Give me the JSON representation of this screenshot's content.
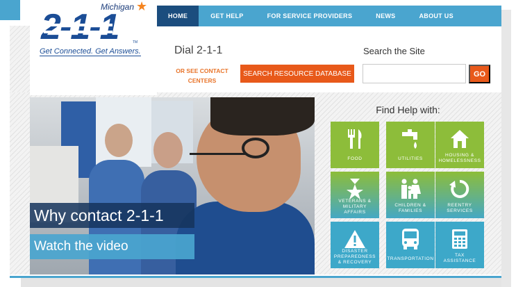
{
  "logo": {
    "state": "Michigan",
    "number": "2-1-1",
    "tagline": "Get Connected. Get Answers.",
    "tm": "TM"
  },
  "nav": {
    "items": [
      "HOME",
      "GET HELP",
      "FOR SERVICE PROVIDERS",
      "NEWS",
      "ABOUT US"
    ],
    "active": "HOME"
  },
  "header": {
    "dial": "Dial 2-1-1",
    "or_see_line1": "OR SEE CONTACT",
    "or_see_line2": "CENTERS",
    "search_db_button": "SEARCH RESOURCE DATABASE",
    "search_label": "Search the Site",
    "search_value": "",
    "go_button": "GO"
  },
  "hero": {
    "headline": "Why contact 2-1-1",
    "video_link": "Watch the video"
  },
  "find_help": {
    "title": "Find Help with:",
    "tiles": [
      {
        "lines": [
          "FOOD"
        ],
        "icon": "fork-knife-icon",
        "style": "green"
      },
      {
        "lines": [
          "UTILITIES"
        ],
        "icon": "faucet-icon",
        "style": "green"
      },
      {
        "lines": [
          "HOUSING &",
          "HOMELESSNESS"
        ],
        "icon": "house-icon",
        "style": "green"
      },
      {
        "lines": [
          "VETERANS &",
          "MILITARY",
          "AFFAIRS"
        ],
        "icon": "medal-icon",
        "style": "gtb"
      },
      {
        "lines": [
          "CHILDREN &",
          "FAMILIES"
        ],
        "icon": "family-icon",
        "style": "gtb"
      },
      {
        "lines": [
          "REENTRY",
          "SERVICES"
        ],
        "icon": "reentry-arrow-icon",
        "style": "gtb"
      },
      {
        "lines": [
          "DISASTER",
          "PREPAREDNESS",
          "& RECOVERY"
        ],
        "icon": "warning-icon",
        "style": "blue"
      },
      {
        "lines": [
          "TRANSPORTATION"
        ],
        "icon": "bus-icon",
        "style": "blue"
      },
      {
        "lines": [
          "TAX",
          "ASSISTANCE"
        ],
        "icon": "calculator-icon",
        "style": "blue"
      }
    ]
  },
  "colors": {
    "nav_blue": "#4aa5cf",
    "nav_active": "#1b4d7e",
    "orange": "#e8591a",
    "tile_green": "#8dbd3a",
    "tile_blue": "#3da8c9",
    "logo_blue": "#1b4d96"
  }
}
